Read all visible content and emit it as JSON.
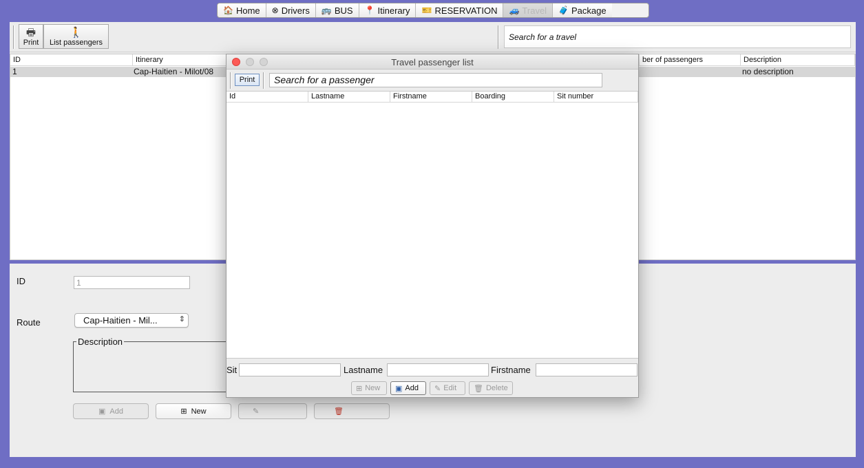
{
  "tabs": [
    {
      "label": "Home",
      "icon": "home-icon",
      "glyph": "🏠"
    },
    {
      "label": "Drivers",
      "icon": "steering-wheel-icon",
      "glyph": "⊗"
    },
    {
      "label": "BUS",
      "icon": "bus-icon",
      "glyph": "🚌"
    },
    {
      "label": "Itinerary",
      "icon": "map-pin-icon",
      "glyph": "📍"
    },
    {
      "label": "RESERVATION",
      "icon": "ticket-icon",
      "glyph": "🎫"
    },
    {
      "label": "Travel",
      "icon": "car-icon",
      "glyph": "🚙"
    },
    {
      "label": "Package",
      "icon": "luggage-icon",
      "glyph": "🧳"
    }
  ],
  "toolbar": {
    "print_label": "Print",
    "list_label": "List passengers",
    "search_placeholder": "Search for a travel"
  },
  "travel_table": {
    "columns": [
      "ID",
      "Itinerary",
      "ber of passengers",
      "Description"
    ],
    "row": {
      "id": "1",
      "itinerary": "Cap-Haitien - Milot/08",
      "description": "no description"
    }
  },
  "form": {
    "id_label": "ID",
    "id_value": "1",
    "route_label": "Route",
    "route_value": "Cap-Haitien - Mil...",
    "description_label": "Description",
    "add_label": "Add",
    "new_label": "New"
  },
  "dialog": {
    "title": "Travel passenger list",
    "print_label": "Print",
    "search_placeholder": "Search for a passenger",
    "columns": [
      "Id",
      "Lastname",
      "Firstname",
      "Boarding",
      "Sit number"
    ],
    "sit_label": "Sit",
    "lastname_label": "Lastname",
    "firstname_label": "Firstname",
    "buttons": {
      "new": "New",
      "add": "Add",
      "edit": "Edit",
      "delete": "Delete"
    }
  }
}
